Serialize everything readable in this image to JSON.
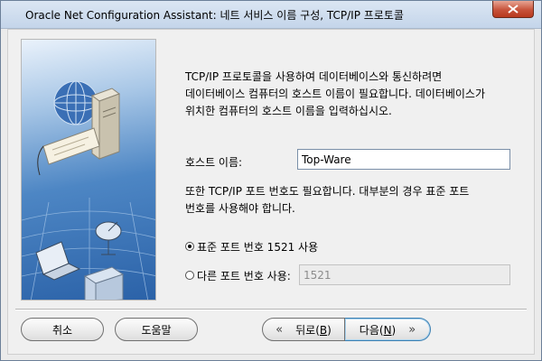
{
  "window": {
    "title": "Oracle Net Configuration Assistant: 네트 서비스 이름 구성, TCP/IP 프로토콜"
  },
  "intro": {
    "line1": "TCP/IP 프로토콜을 사용하여 데이터베이스와 통신하려면",
    "line2": "데이터베이스 컴퓨터의 호스트 이름이 필요합니다. 데이터베이스가",
    "line3": "위치한 컴퓨터의 호스트 이름을 입력하십시오."
  },
  "host": {
    "label": "호스트 이름:",
    "value": "Top-Ware"
  },
  "port_info": {
    "line1": "또한 TCP/IP 포트 번호도 필요합니다. 대부분의 경우 표준 포트",
    "line2": "번호를 사용해야 합니다."
  },
  "port_options": {
    "standard_label": "표준 포트 번호 1521 사용",
    "custom_label": "다른 포트 번호 사용:",
    "custom_value": "1521",
    "selected": "standard"
  },
  "buttons": {
    "cancel": "취소",
    "help": "도움말",
    "back_text": "뒤로",
    "back_key": "B",
    "next_text": "다음",
    "next_key": "N"
  },
  "icons": {
    "close": "close-icon",
    "back": "chevron-left-double-icon",
    "next": "chevron-right-double-icon"
  },
  "colors": {
    "titlebar": "#c4d5ea",
    "close_button": "#c7533b",
    "illustration_blue": "#2b62a8"
  }
}
